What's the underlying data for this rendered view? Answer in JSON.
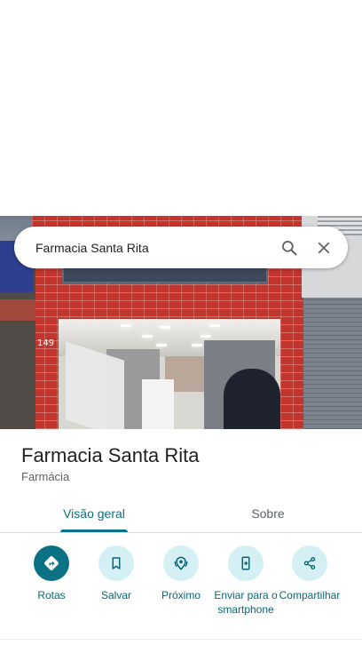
{
  "search": {
    "query": "Farmacia Santa Rita"
  },
  "photo": {
    "street_number": "149"
  },
  "place": {
    "name": "Farmacia Santa Rita",
    "category": "Farmácia"
  },
  "tabs": [
    {
      "label": "Visão geral",
      "selected": true
    },
    {
      "label": "Sobre",
      "selected": false
    }
  ],
  "actions": [
    {
      "label": "Rotas",
      "icon": "directions-icon"
    },
    {
      "label": "Salvar",
      "icon": "bookmark-icon"
    },
    {
      "label": "Próximo",
      "icon": "nearby-icon"
    },
    {
      "label": "Enviar para o smartphone",
      "icon": "send-to-phone-icon"
    },
    {
      "label": "Compartilhar",
      "icon": "share-icon"
    }
  ],
  "colors": {
    "accent": "#0b7285",
    "action_bg": "#d4f0f5",
    "secondary_text": "#5f6368"
  }
}
